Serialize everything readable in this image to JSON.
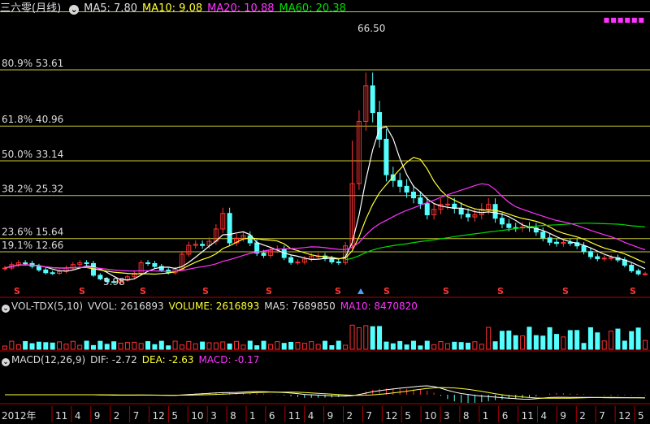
{
  "header": {
    "title": "三六零(月线)",
    "ma5": "MA5: 7.80",
    "ma10": "MA10: 9.08",
    "ma20": "MA20: 10.88",
    "ma60": "MA60: 20.38"
  },
  "price_panel": {
    "fib_levels": [
      {
        "label": "80.9% 53.61",
        "value": 53.61
      },
      {
        "label": "61.8% 40.96",
        "value": 40.96
      },
      {
        "label": "50.0% 33.14",
        "value": 33.14
      },
      {
        "label": "38.2% 25.32",
        "value": 25.32
      },
      {
        "label": "23.6% 15.64",
        "value": 15.64
      },
      {
        "label": "19.1% 12.66",
        "value": 12.66
      }
    ],
    "high_label": "66.50",
    "low_label": "5.98"
  },
  "volume_panel": {
    "title": "VOL-TDX(5,10)",
    "vvol": "VVOL: 2616893",
    "volume": "VOLUME: 2616893",
    "ma5": "MA5: 7689850",
    "ma10": "MA10: 8470820"
  },
  "macd_panel": {
    "title": "MACD(12,26,9)",
    "dif": "DIF: -2.72",
    "dea": "DEA: -2.63",
    "macd": "MACD: -0.17"
  },
  "axis": {
    "labels": [
      "2012年",
      "11",
      "4",
      "9",
      "2",
      "7",
      "12",
      "5",
      "10",
      "3",
      "8",
      "1",
      "6",
      "11",
      "4",
      "9",
      "2",
      "7",
      "12",
      "5",
      "10",
      "3",
      "8",
      "1",
      "6",
      "11",
      "4",
      "9",
      "2",
      "7",
      "12",
      "5"
    ]
  },
  "colors": {
    "up": "#ff3333",
    "down": "#54ffff",
    "ma5": "#ffffff",
    "ma10": "#ffff33",
    "ma20": "#ff33ff",
    "ma60": "#00dd00",
    "fib": "#c8c832",
    "panel_sep": "#b00000"
  }
}
